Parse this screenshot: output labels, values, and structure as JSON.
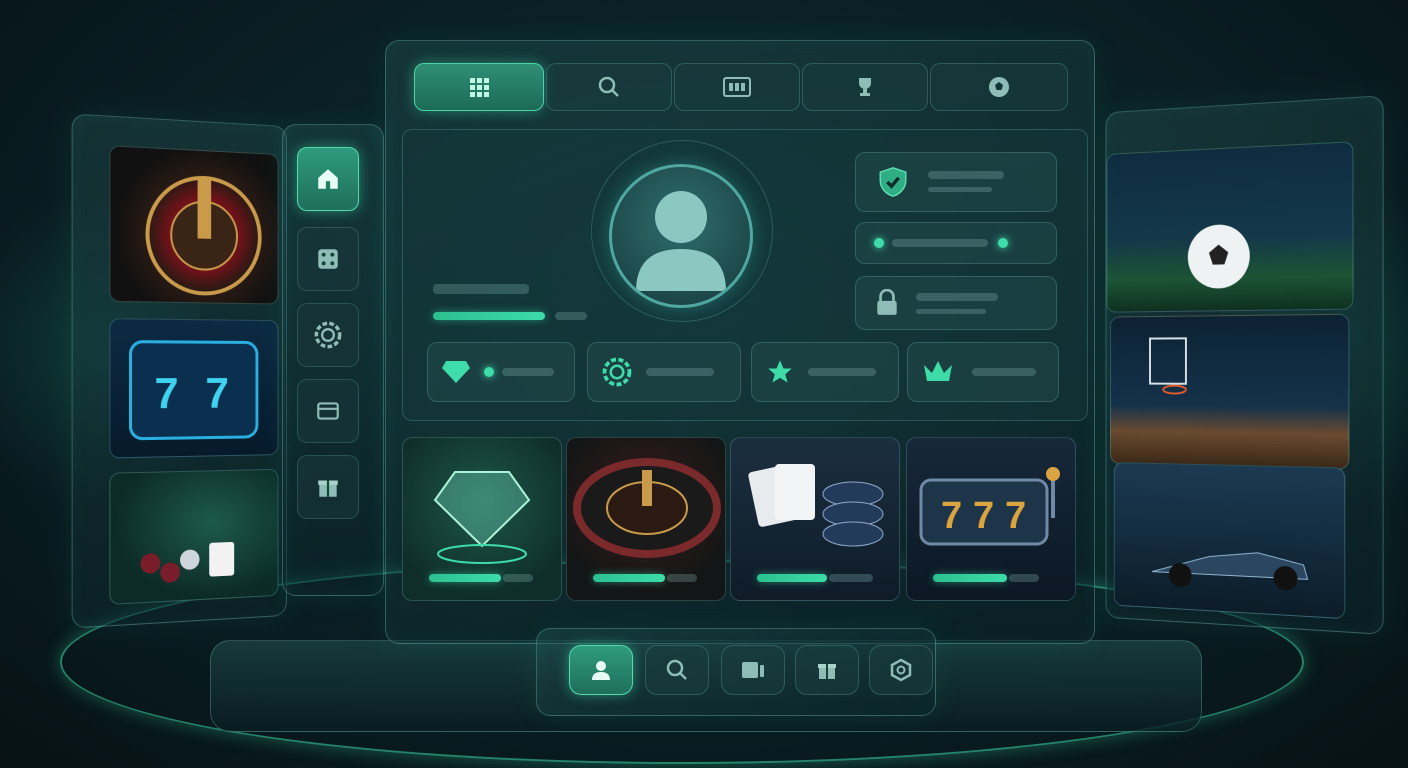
{
  "theme": {
    "accent": "#3ddca8",
    "panel": "#0f2e31",
    "background": "#07171b"
  },
  "top_tabs": [
    {
      "icon": "grid-icon",
      "active": true
    },
    {
      "icon": "search-icon",
      "active": false
    },
    {
      "icon": "slot-reels-icon",
      "active": false
    },
    {
      "icon": "trophy-icon",
      "active": false
    },
    {
      "icon": "soccer-ball-icon",
      "active": false
    }
  ],
  "sidebar": {
    "items": [
      {
        "icon": "home-icon",
        "active": true
      },
      {
        "icon": "dice-icon",
        "active": false
      },
      {
        "icon": "poker-chip-icon",
        "active": false
      },
      {
        "icon": "wallet-icon",
        "active": false
      },
      {
        "icon": "gift-icon",
        "active": false
      }
    ]
  },
  "profile": {
    "avatar": "user-avatar-icon",
    "progress": 0.7
  },
  "status_cards": [
    {
      "icon": "shield-check-icon"
    },
    {
      "icon": "toggle-slider"
    },
    {
      "icon": "lock-icon"
    }
  ],
  "stats": [
    {
      "icon": "diamond-icon"
    },
    {
      "icon": "poker-chip-icon"
    },
    {
      "icon": "star-icon"
    },
    {
      "icon": "crown-icon"
    }
  ],
  "game_tiles": [
    {
      "art": "diamond-art",
      "progress": 0.7
    },
    {
      "art": "roulette-art",
      "progress": 0.7
    },
    {
      "art": "cards-chips-art",
      "progress": 0.6
    },
    {
      "art": "slot-777-art",
      "progress": 0.7
    }
  ],
  "left_panel": [
    {
      "art": "roulette-art"
    },
    {
      "art": "slot-777-art"
    },
    {
      "art": "poker-table-art"
    }
  ],
  "right_panel": [
    {
      "art": "soccer-stadium-art"
    },
    {
      "art": "basketball-court-art"
    },
    {
      "art": "race-car-art"
    }
  ],
  "dock": [
    {
      "icon": "user-icon",
      "active": true
    },
    {
      "icon": "search-icon",
      "active": false
    },
    {
      "icon": "cards-icon",
      "active": false
    },
    {
      "icon": "gift-icon",
      "active": false
    },
    {
      "icon": "settings-icon",
      "active": false
    }
  ]
}
